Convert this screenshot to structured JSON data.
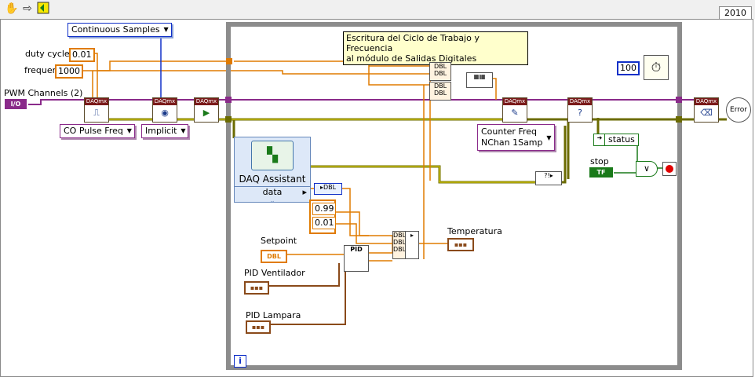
{
  "toolbar": {
    "hand_icon": "hand-icon",
    "arrow_icon": "arrow-icon",
    "run_icon": "run-icon"
  },
  "version_tab": "2010",
  "controls": {
    "continuous_samples": "Continuous Samples",
    "duty_cycle_label": "duty cycle",
    "duty_cycle_value": "0.01",
    "frequency_label": "frequency",
    "frequency_value": "1000",
    "pwm_channels_label": "PWM Channels (2)",
    "pwm_channels_terminal": "I/O",
    "co_pulse_freq": "CO Pulse Freq",
    "implicit": "Implicit",
    "counter_freq_line1": "Counter Freq",
    "counter_freq_line2": "NChan 1Samp",
    "wait_value": "100",
    "status_label": "status",
    "stop_label": "stop",
    "stop_terminal": "TF"
  },
  "comment": {
    "line1": "Escritura del Ciclo de Trabajo y Frecuencia",
    "line2": "al módulo de Salidas Digitales"
  },
  "daq_assistant": {
    "title": "DAQ Assistant",
    "output": "data"
  },
  "constants": {
    "upper": "0.99",
    "lower": "0.01"
  },
  "pid": {
    "setpoint_label": "Setpoint",
    "setpoint_terminal": "DBL",
    "pid_ventilador_label": "PID Ventilador",
    "pid_lampara_label": "PID Lampara",
    "node_label": "PID",
    "temperatura_label": "Temperatura",
    "dbl_label": "DBL",
    "cluster_terminal": "90̂B"
  },
  "daqmx_label": "DAQmx",
  "error_label": "Error",
  "info_icon": "i"
}
